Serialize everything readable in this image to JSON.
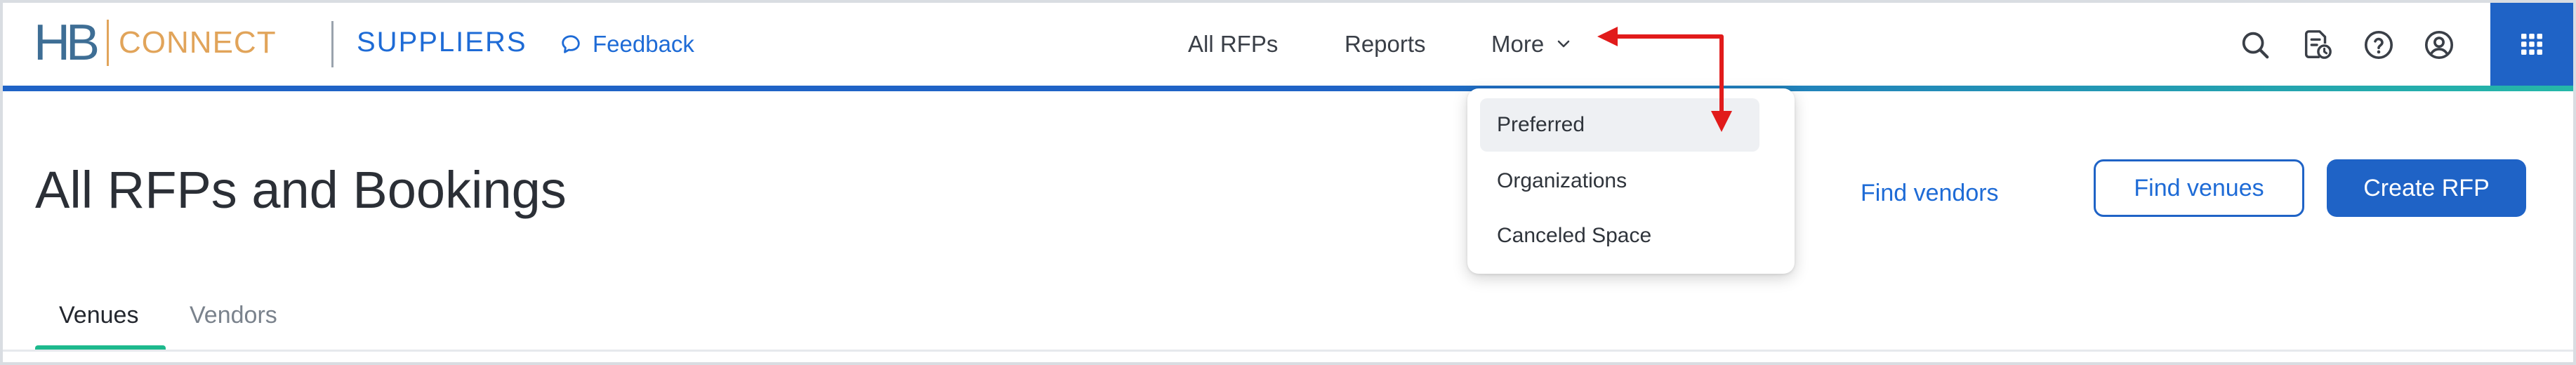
{
  "logo": {
    "mark": "HB",
    "product": "CONNECT"
  },
  "brand": {
    "section": "SUPPLIERS"
  },
  "feedback": {
    "label": "Feedback",
    "icon": "chat-bubble-icon"
  },
  "nav": {
    "items": [
      {
        "label": "All RFPs"
      },
      {
        "label": "Reports"
      },
      {
        "label": "More"
      }
    ]
  },
  "more_menu": {
    "items": [
      {
        "label": "Preferred",
        "highlighted": true
      },
      {
        "label": "Organizations"
      },
      {
        "label": "Canceled Space"
      }
    ]
  },
  "top_icons": [
    "search-icon",
    "document-clock-icon",
    "help-icon",
    "account-icon",
    "apps-grid-icon"
  ],
  "page": {
    "title": "All RFPs and Bookings"
  },
  "actions": {
    "find_vendors": "Find vendors",
    "find_venues": "Find venues",
    "create_rfp": "Create RFP"
  },
  "tabs": [
    {
      "label": "Venues",
      "selected": true
    },
    {
      "label": "Vendors",
      "selected": false
    }
  ],
  "colors": {
    "primary": "#1f63c6",
    "accent_teal": "#1db98d",
    "logo_orange": "#e1a45a",
    "annotation_red": "#e11b1b"
  }
}
